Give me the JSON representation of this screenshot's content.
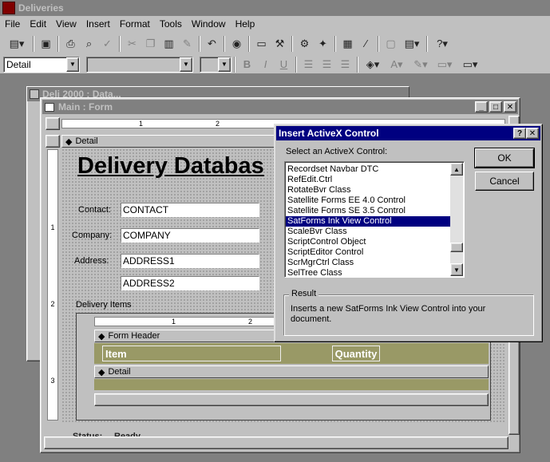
{
  "app": {
    "title": "Deliveries"
  },
  "menu": [
    "File",
    "Edit",
    "View",
    "Insert",
    "Format",
    "Tools",
    "Window",
    "Help"
  ],
  "format_toolbar": {
    "object_combo": "Detail",
    "font_combo": "",
    "size_combo": ""
  },
  "back_window": {
    "title": "Deli 2000 : Data..."
  },
  "form_window": {
    "title": "Main : Form",
    "ruler_numbers": [
      "1",
      "2"
    ],
    "section_detail": "Detail",
    "heading": "Delivery Databas",
    "labels": {
      "contact": "Contact:",
      "company": "Company:",
      "address": "Address:"
    },
    "fields": {
      "contact": "CONTACT",
      "company": "COMPANY",
      "address1": "ADDRESS1",
      "address2": "ADDRESS2"
    },
    "subform": {
      "label": "Delivery Items",
      "ruler_numbers": [
        "1",
        "2"
      ],
      "form_header": "Form Header",
      "col_item": "Item",
      "col_quantity": "Quantity",
      "detail": "Detail"
    },
    "status_label": "Status:",
    "status_value": "Ready",
    "vertical_ruler": [
      "1",
      "2",
      "3"
    ]
  },
  "dialog": {
    "title": "Insert ActiveX Control",
    "prompt": "Select an ActiveX Control:",
    "items": [
      "Recordset Navbar DTC",
      "RefEdit.Ctrl",
      "RotateBvr Class",
      "Satellite Forms EE 4.0 Control",
      "Satellite Forms SE 3.5 Control",
      "SatForms Ink View Control",
      "ScaleBvr Class",
      "ScriptControl Object",
      "ScriptEditor Control",
      "ScrMgrCtrl Class",
      "SelTree Class"
    ],
    "selected_index": 5,
    "ok": "OK",
    "cancel": "Cancel",
    "result_label": "Result",
    "result_text": "Inserts a new SatForms Ink View Control into your document."
  }
}
